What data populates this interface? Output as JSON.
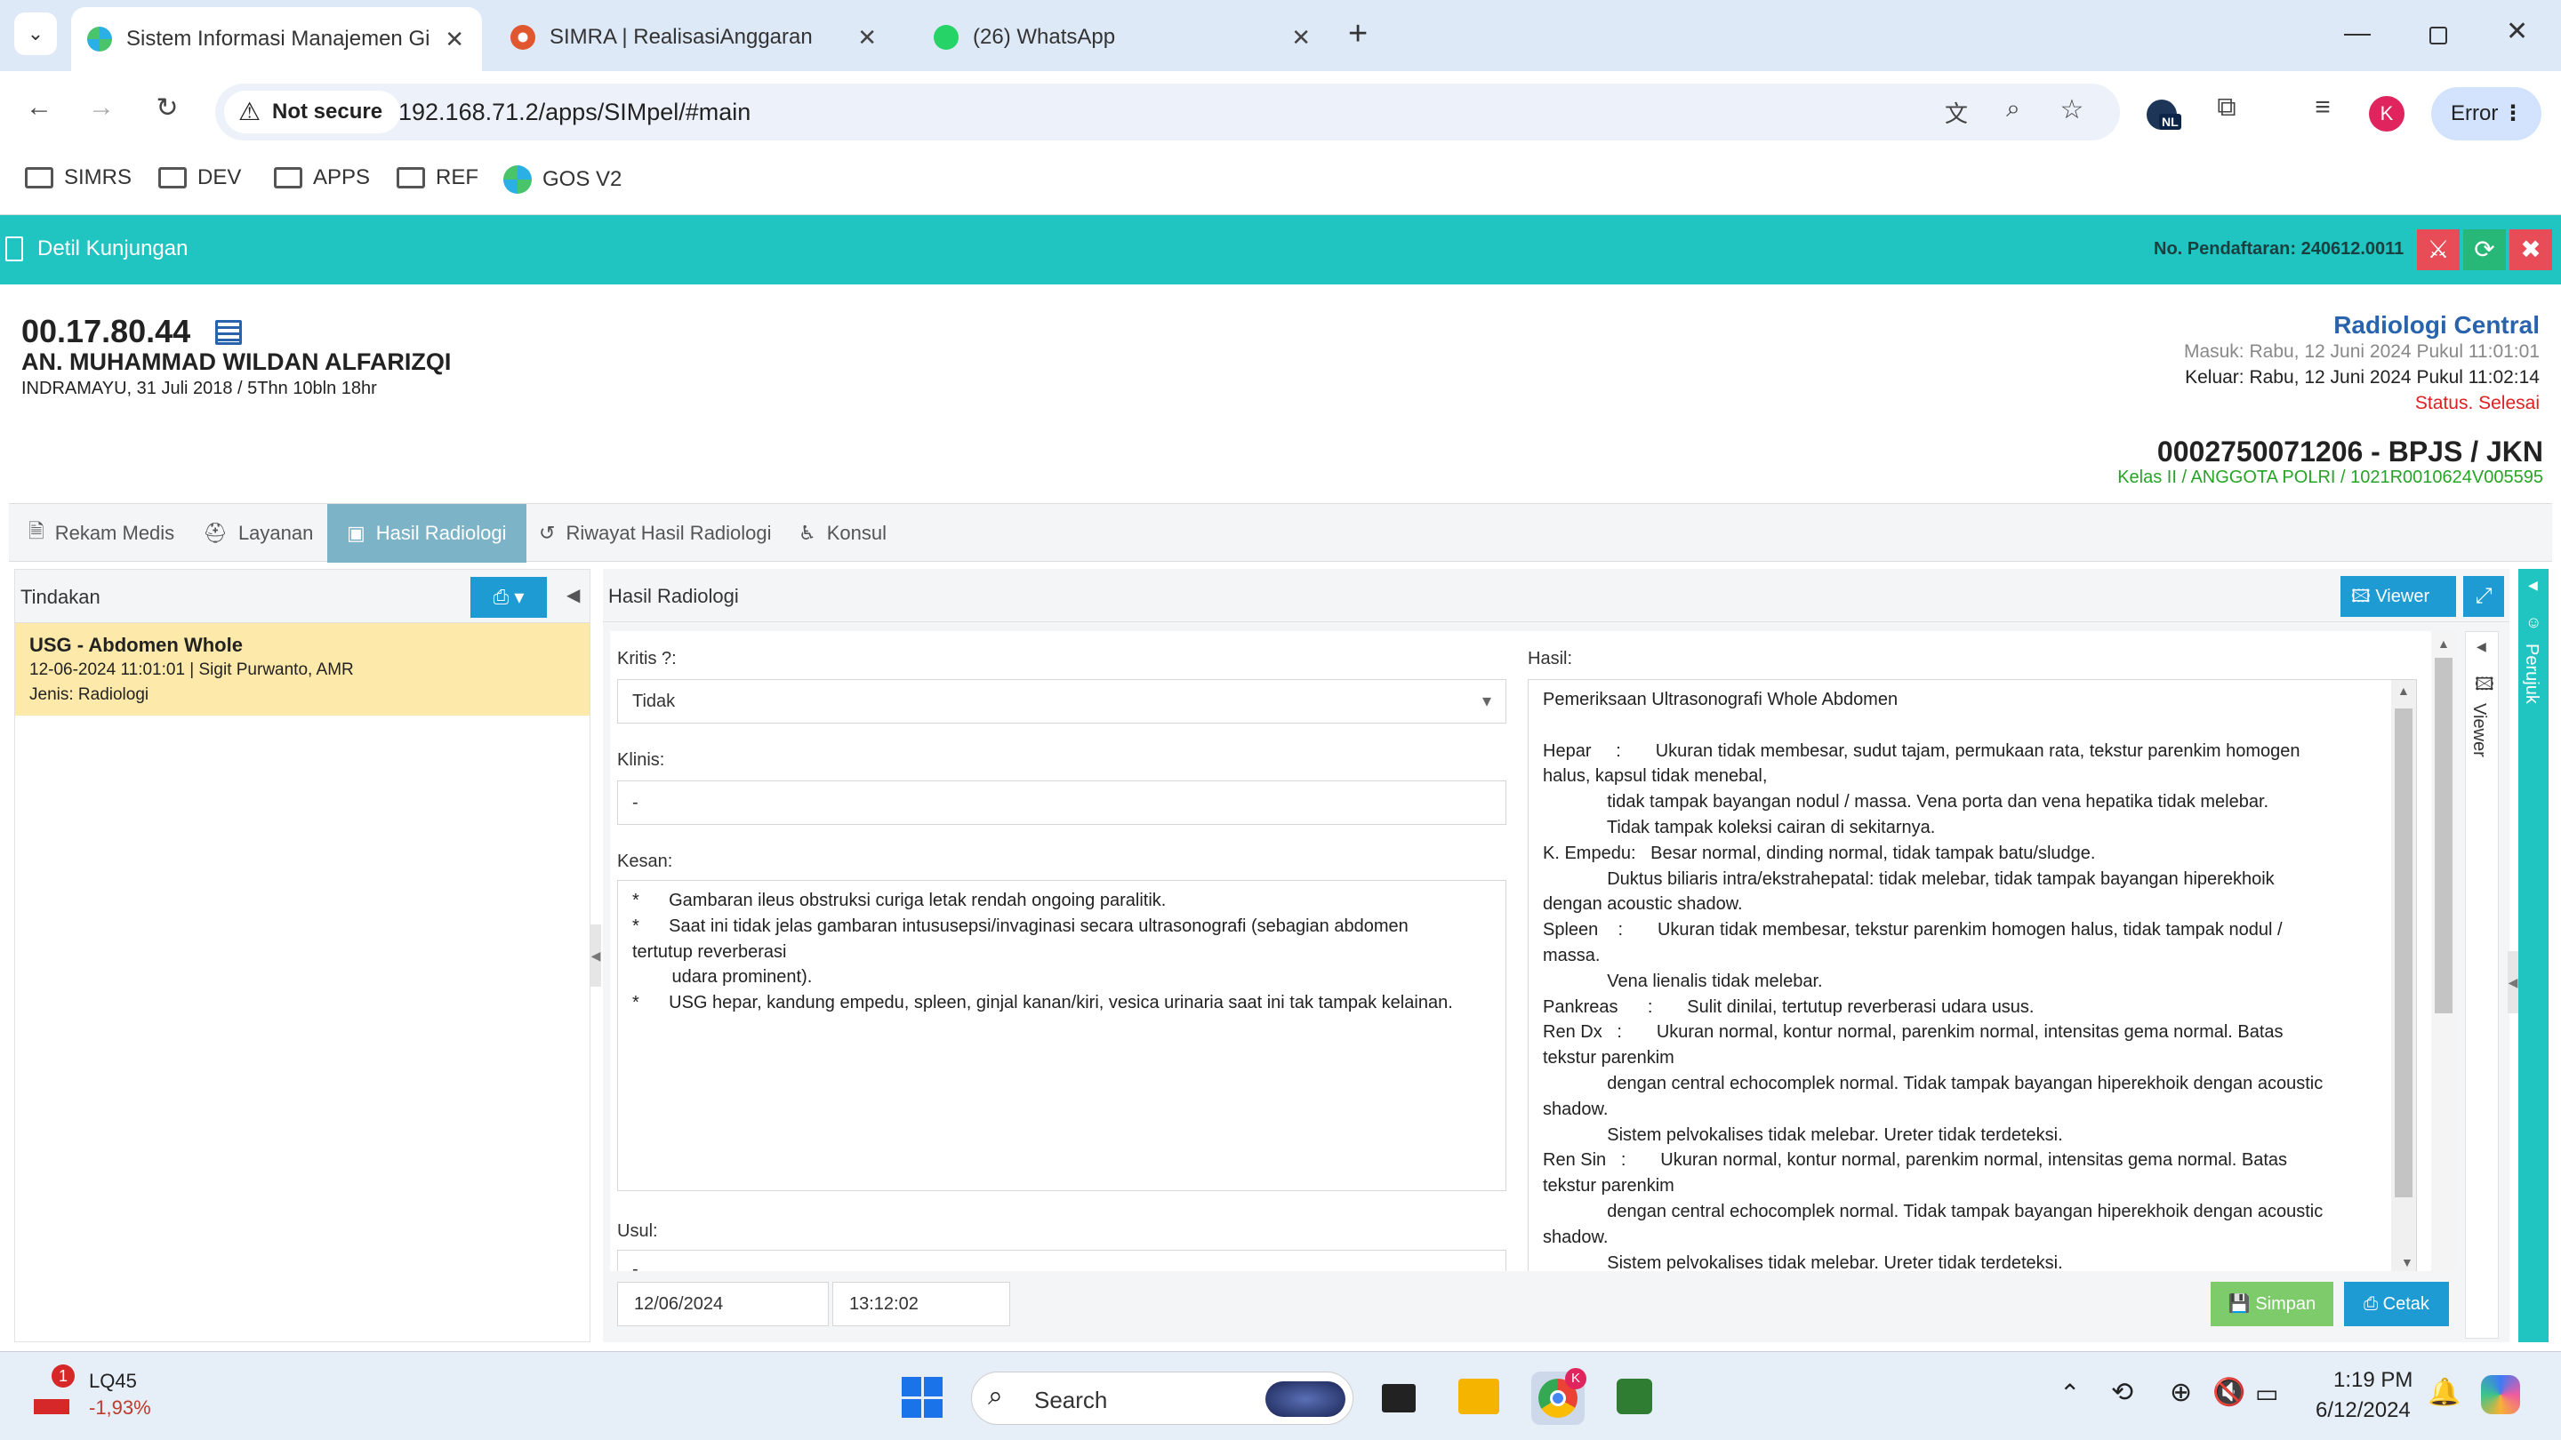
{
  "browser": {
    "tabs": [
      {
        "title": "Sistem Informasi Manajemen Gi"
      },
      {
        "title": "SIMRA | RealisasiAnggaran"
      },
      {
        "title": "(26) WhatsApp"
      }
    ],
    "new_tab": "+",
    "security": "Not secure",
    "url": "192.168.71.2/apps/SIMpel/#main",
    "profile_initial": "K",
    "error_label": "Error",
    "ext_badge": "NL",
    "bookmarks": [
      "SIMRS",
      "DEV",
      "APPS",
      "REF",
      "GOS V2"
    ]
  },
  "app": {
    "title": "Detil Kunjungan",
    "no_pendaftaran": "No. Pendaftaran: 240612.0011"
  },
  "patient": {
    "rm": "00.17.80.44",
    "name": "AN. MUHAMMAD WILDAN ALFARIZQI",
    "birth": "INDRAMAYU, 31 Juli 2018 / 5Thn 10bln 18hr",
    "unit": "Radiologi Central",
    "masuk": "Masuk: Rabu, 12 Juni 2024 Pukul 11:01:01",
    "keluar": "Keluar: Rabu, 12 Juni 2024 Pukul 11:02:14",
    "status": "Status. Selesai",
    "insurance": "0002750071206 - BPJS / JKN",
    "kelas": "Kelas II / ANGGOTA POLRI / 1021R0010624V005595"
  },
  "tabs": [
    "Rekam Medis",
    "Layanan",
    "Hasil Radiologi",
    "Riwayat Hasil Radiologi",
    "Konsul"
  ],
  "tindakan": {
    "header": "Tindakan",
    "item": {
      "name": "USG - Abdomen Whole",
      "meta": "12-06-2024 11:01:01 | Sigit Purwanto, AMR",
      "jenis": "Jenis: Radiologi"
    }
  },
  "hasil_panel": {
    "header": "Hasil Radiologi",
    "viewer_button": "Viewer",
    "kritis_label": "Kritis ?:",
    "kritis_value": "Tidak",
    "klinis_label": "Klinis:",
    "klinis_value": "-",
    "kesan_label": "Kesan:",
    "kesan_lines": [
      "*      Gambaran ileus obstruksi curiga letak rendah ongoing paralitik.",
      "*      Saat ini tidak jelas gambaran intususepsi/invaginasi secara ultrasonografi (sebagian abdomen",
      "tertutup reverberasi",
      "        udara prominent).",
      "*      USG hepar, kandung empedu, spleen, ginjal kanan/kiri, vesica urinaria saat ini tak tampak kelainan."
    ],
    "usul_label": "Usul:",
    "usul_value": "-",
    "hasil_label": "Hasil:",
    "hasil_lines": [
      "Pemeriksaan Ultrasonografi Whole Abdomen",
      "",
      "Hepar     :       Ukuran tidak membesar, sudut tajam, permukaan rata, tekstur parenkim homogen",
      "halus, kapsul tidak menebal,",
      "             tidak tampak bayangan nodul / massa. Vena porta dan vena hepatika tidak melebar.",
      "             Tidak tampak koleksi cairan di sekitarnya.",
      "K. Empedu:   Besar normal, dinding normal, tidak tampak batu/sludge.",
      "             Duktus biliaris intra/ekstrahepatal: tidak melebar, tidak tampak bayangan hiperekhoik",
      "dengan acoustic shadow.",
      "Spleen    :       Ukuran tidak membesar, tekstur parenkim homogen halus, tidak tampak nodul /",
      "massa.",
      "             Vena lienalis tidak melebar.",
      "Pankreas      :       Sulit dinilai, tertutup reverberasi udara usus.",
      "Ren Dx   :       Ukuran normal, kontur normal, parenkim normal, intensitas gema normal. Batas",
      "tekstur parenkim",
      "             dengan central echocomplek normal. Tidak tampak bayangan hiperekhoik dengan acoustic",
      "shadow.",
      "             Sistem pelvokalises tidak melebar. Ureter tidak terdeteksi.",
      "Ren Sin   :       Ukuran normal, kontur normal, parenkim normal, intensitas gema normal. Batas",
      "tekstur parenkim",
      "             dengan central echocomplek normal. Tidak tampak bayangan hiperekhoik dengan acoustic",
      "shadow.",
      "             Sistem pelvokalises tidak melebar. Ureter tidak terdeteksi."
    ],
    "date": "12/06/2024",
    "time": "13:12:02",
    "simpan": "Simpan",
    "cetak": "Cetak",
    "side_viewer": "Viewer",
    "side_perujuk": "Perujuk"
  },
  "taskbar": {
    "stock_name": "LQ45",
    "stock_change": "-1,93%",
    "stock_badge": "1",
    "search": "Search",
    "time": "1:19 PM",
    "date": "6/12/2024",
    "chrome_badge": "K"
  },
  "colors": {
    "teal": "#20c4c0",
    "tab_active": "#7cb3c6",
    "selected_row": "#fde9a9",
    "blue_btn": "#1f9bd4",
    "green_btn": "#7ecb6b"
  }
}
